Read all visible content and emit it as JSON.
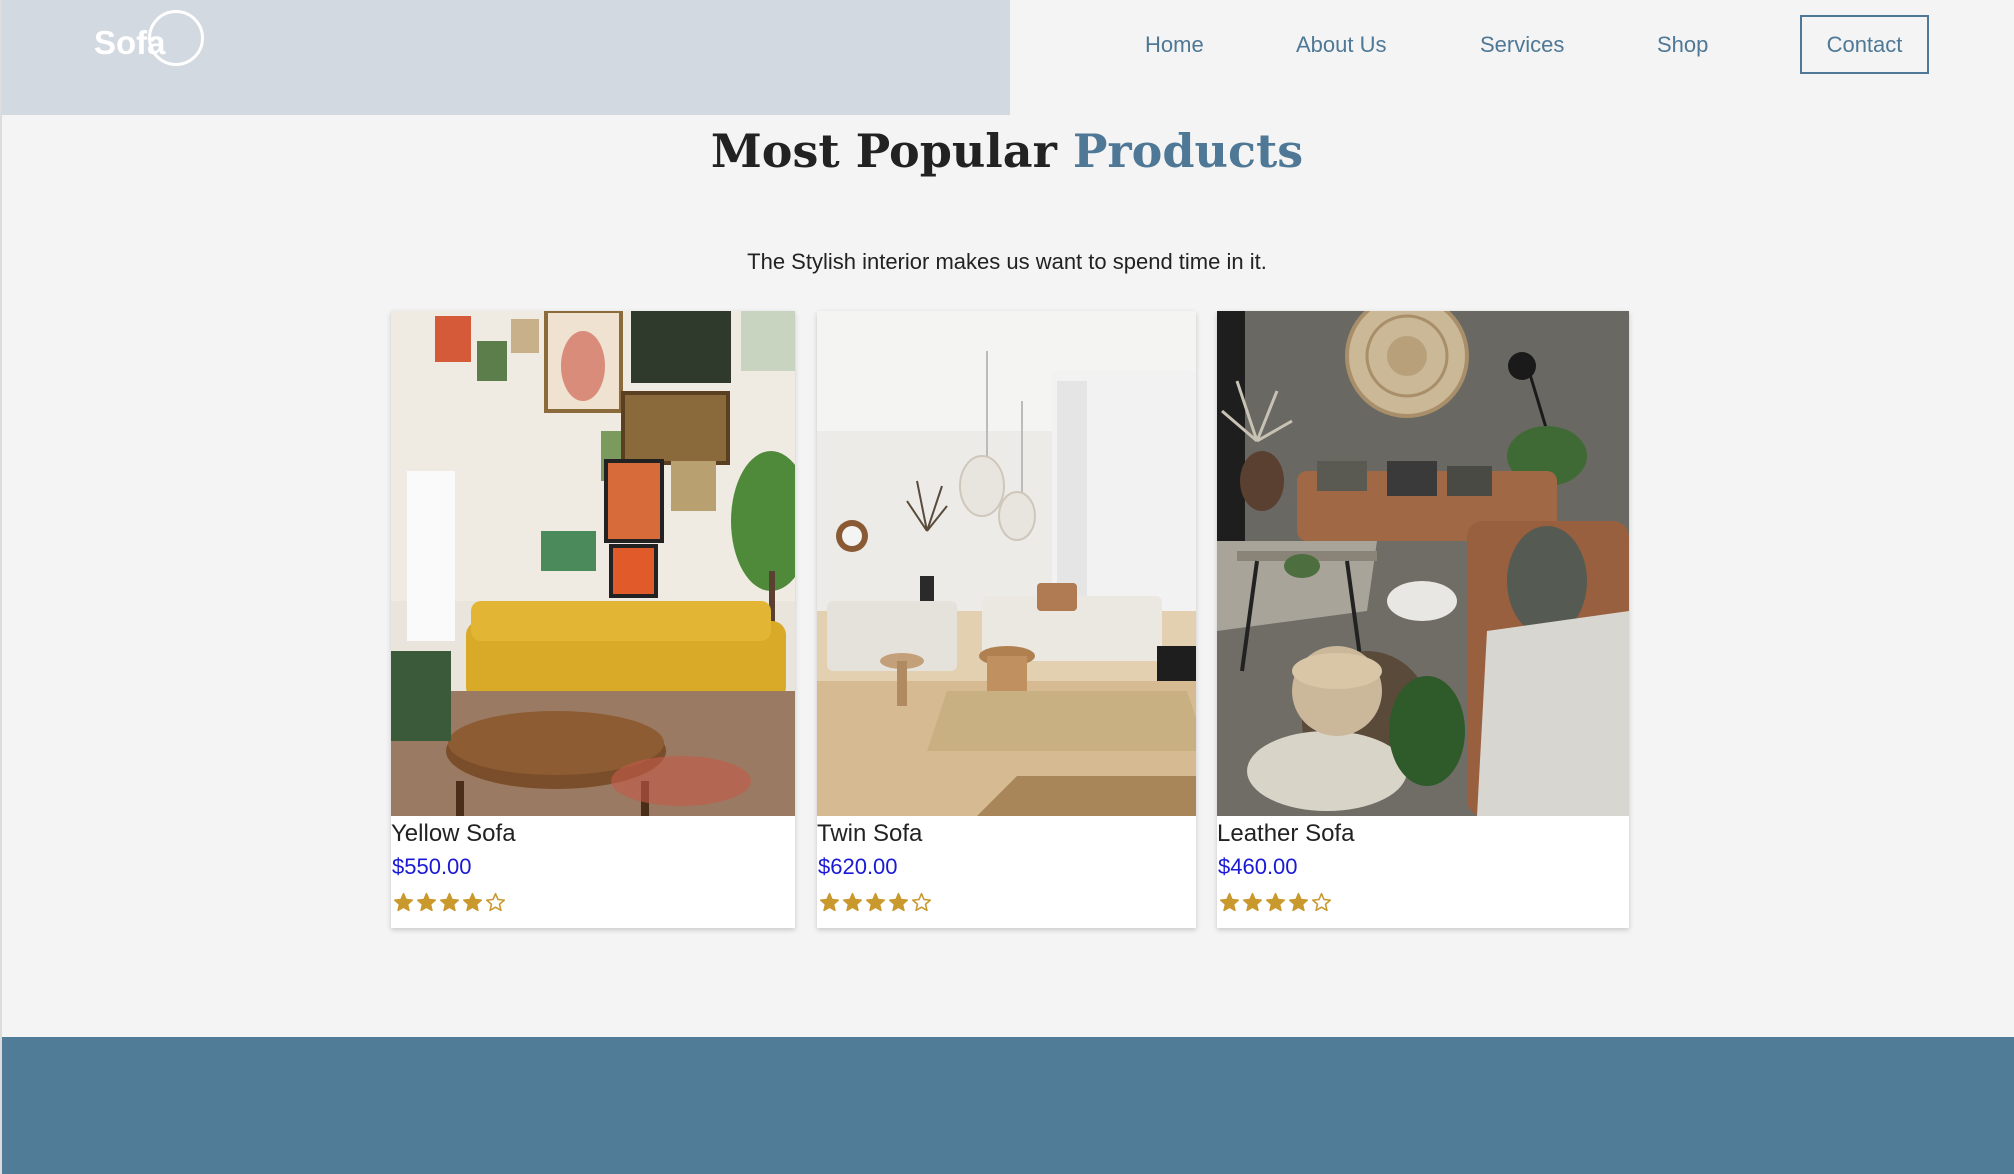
{
  "brand": {
    "logo_text": "Sofa"
  },
  "nav": {
    "home": "Home",
    "about": "About Us",
    "services": "Services",
    "shop": "Shop",
    "contact": "Contact"
  },
  "section": {
    "title_plain": "Most Popular ",
    "title_accent": "Products",
    "subtitle": "The Stylish interior makes us want to spend time in it."
  },
  "products": [
    {
      "name": "Yellow Sofa",
      "price": "$550.00",
      "rating": 4,
      "max_rating": 5
    },
    {
      "name": "Twin Sofa",
      "price": "$620.00",
      "rating": 4,
      "max_rating": 5
    },
    {
      "name": "Leather Sofa",
      "price": "$460.00",
      "rating": 4,
      "max_rating": 5
    }
  ],
  "colors": {
    "accent": "#4e7896",
    "header_band": "#d3d9e0",
    "footer_band": "#517c98",
    "price": "#1a1ad6",
    "star": "#c9992e"
  }
}
